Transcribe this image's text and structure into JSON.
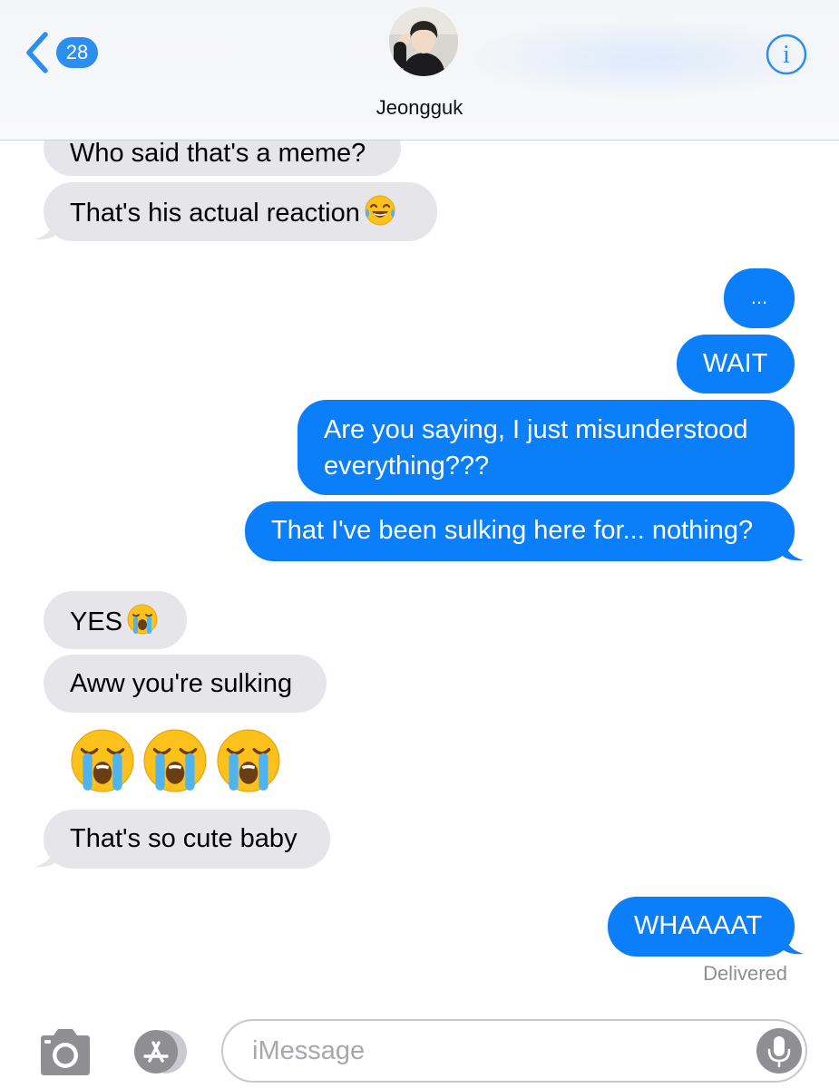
{
  "header": {
    "back_count": "28",
    "contact_name": "Jeongguk",
    "avatar_icon": "contact-photo",
    "info_icon": "info-icon"
  },
  "messages": [
    {
      "from": "contact",
      "text": "Who said that's a meme?"
    },
    {
      "from": "contact",
      "text": "That's his actual reaction",
      "emoji": "face-with-tears-of-joy"
    },
    {
      "from": "me",
      "text": "..."
    },
    {
      "from": "me",
      "text": "WAIT"
    },
    {
      "from": "me",
      "text": "Are you saying, I just misunderstood everything???"
    },
    {
      "from": "me",
      "text": "That I've been sulking here for... nothing?"
    },
    {
      "from": "contact",
      "text": "YES",
      "emoji": "loudly-crying-face"
    },
    {
      "from": "contact",
      "text": "Aww you're sulking"
    },
    {
      "from": "contact",
      "emoji_only": [
        "loudly-crying-face",
        "loudly-crying-face",
        "loudly-crying-face"
      ]
    },
    {
      "from": "contact",
      "text": "That's so cute baby"
    },
    {
      "from": "me",
      "text": "WHAAAAT"
    }
  ],
  "status": {
    "delivered": "Delivered"
  },
  "input_bar": {
    "placeholder": "iMessage",
    "camera_icon": "camera-icon",
    "apps_icon": "app-store-icon",
    "mic_icon": "microphone-icon"
  },
  "colors": {
    "sent_bubble": "#0b7efa",
    "received_bubble": "#e5e5ea",
    "accent": "#2b8ef0"
  }
}
